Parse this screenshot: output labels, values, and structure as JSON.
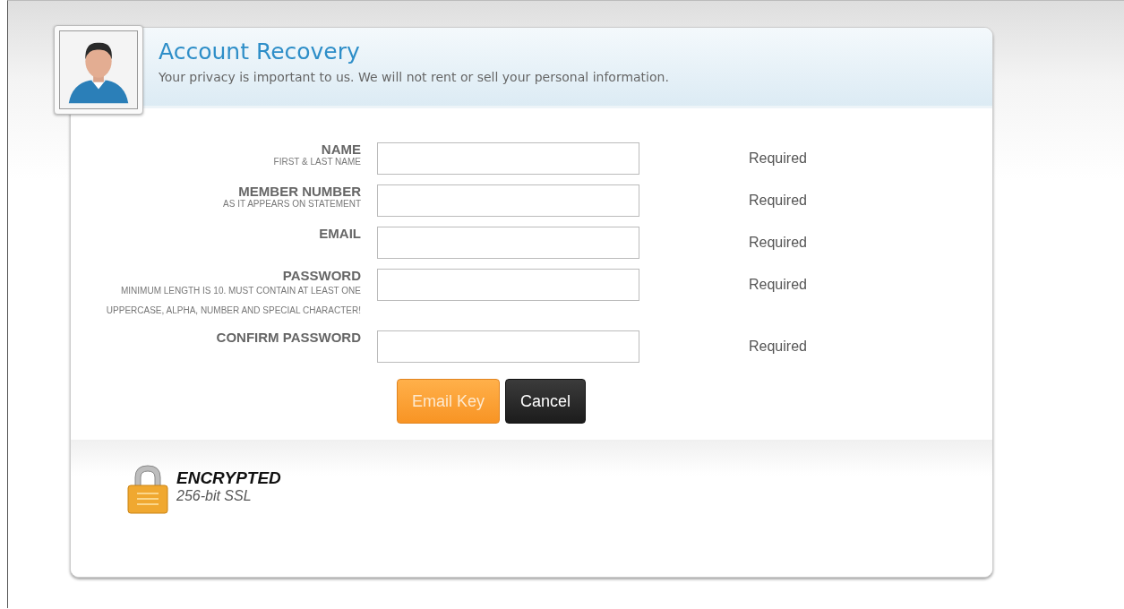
{
  "header": {
    "title": "Account Recovery",
    "subtitle": "Your privacy is important to us. We will not rent or sell your personal information."
  },
  "fields": [
    {
      "label": "NAME",
      "hint": "FIRST & LAST NAME",
      "status": "Required",
      "kind": "text"
    },
    {
      "label": "MEMBER NUMBER",
      "hint": "AS IT APPEARS ON STATEMENT",
      "status": "Required",
      "kind": "text"
    },
    {
      "label": "EMAIL",
      "status": "Required",
      "kind": "text"
    },
    {
      "label": "PASSWORD",
      "hint": "MINIMUM LENGTH IS 10. MUST CONTAIN AT LEAST ONE UPPERCASE, ALPHA, NUMBER AND SPECIAL CHARACTER!",
      "status": "Required",
      "kind": "password"
    },
    {
      "label": "CONFIRM PASSWORD",
      "status": "Required",
      "kind": "password"
    }
  ],
  "buttons": [
    {
      "label": "Email Key",
      "kind": "primary"
    },
    {
      "label": "Cancel",
      "kind": "secondary"
    }
  ],
  "badge": {
    "title": "ENCRYPTED",
    "subtitle": "256-bit SSL"
  }
}
